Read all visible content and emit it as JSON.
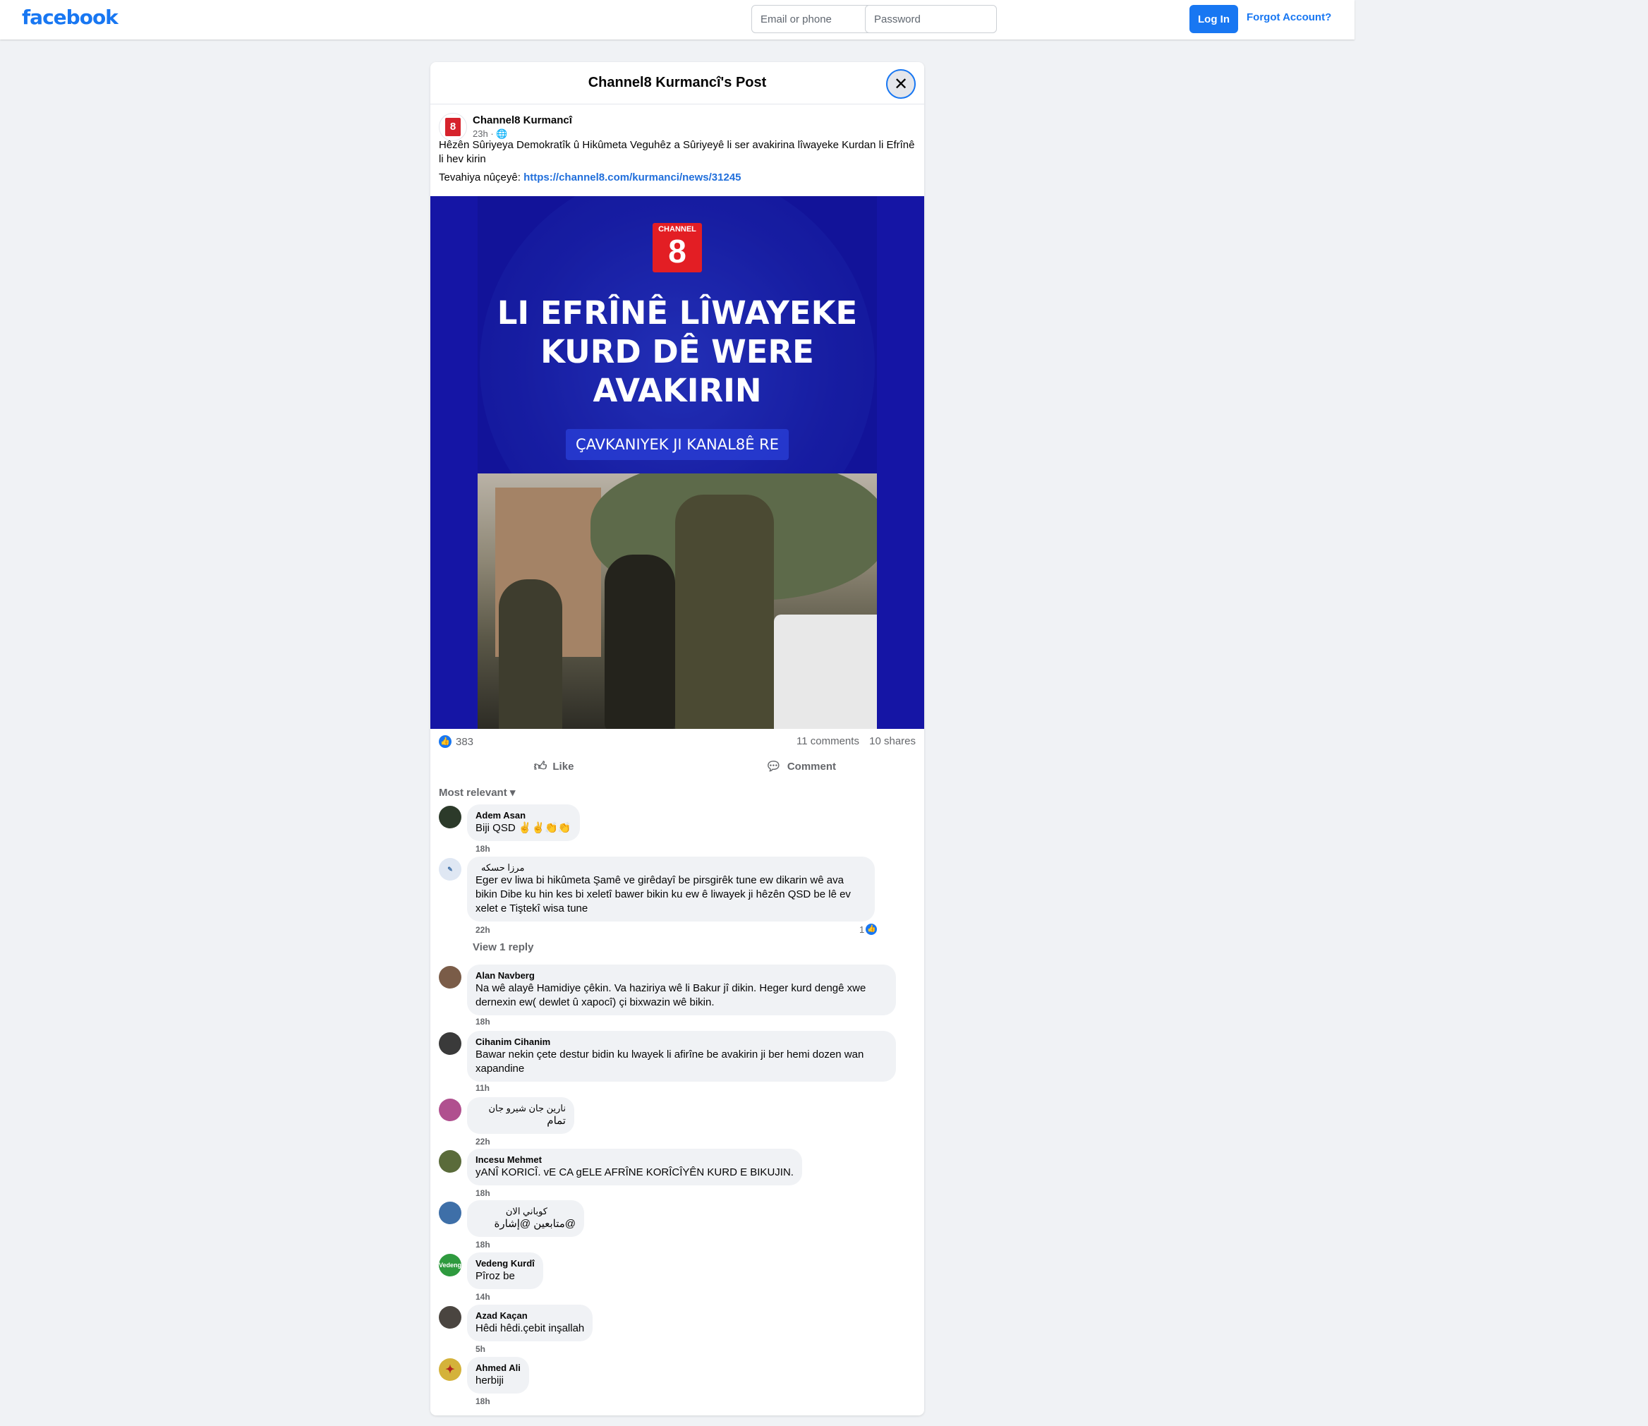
{
  "topbar": {
    "logo": "facebook",
    "email_placeholder": "Email or phone",
    "password_placeholder": "Password",
    "login_label": "Log In",
    "forgot_label": "Forgot Account?"
  },
  "dialog": {
    "title": "Channel8 Kurmancî's Post",
    "close_icon": "close-icon"
  },
  "post": {
    "page_name": "Channel8 Kurmancî",
    "avatar_badge": "8",
    "time": "23h",
    "audience_icon": "globe-icon",
    "text": "Hêzên Sûriyeya Demokratîk û Hikûmeta Veguhêz a Sûriyeyê li ser avakirina lîwayeke Kurdan li Efrînê li hev kirin",
    "link_prefix": "Tevahiya nûçeyê:",
    "link_url": "https://channel8.com/kurmanci/news/31245",
    "image": {
      "logo_top": "CHANNEL",
      "logo_num": "8",
      "headline": "LI EFRÎNÊ LÎWAYEKE\nKURD DÊ WERE\nAVAKIRIN",
      "source": "ÇAVKANIYEK JI KANAL8Ê RE"
    },
    "likes": "383",
    "comments": "11 comments",
    "shares": "10 shares",
    "like_label": "Like",
    "comment_label": "Comment",
    "sort_label": "Most relevant"
  },
  "comments": [
    {
      "author": "Adem Asan",
      "text": "Biji QSD ✌️✌️👏👏",
      "time": "18h",
      "avatar_color": "#2c3a2a"
    },
    {
      "author": "مرزا حسكه",
      "text": "Eger ev liwa bi hikûmeta Şamê ve girêdayî be pirsgirêk tune ew dikarin wê ava bikin Dibe ku hin kes bi xeletî bawer bikin ku ew ê liwayek ji hêzên QSD be lê ev xelet e Tiştekî wisa tune",
      "time": "22h",
      "reactions": "1",
      "view_reply": "View 1 reply",
      "avatar_color": "#dfe7f3"
    },
    {
      "author": "Alan Navberg",
      "text": "Na wê alayê Hamidiye çêkin. Va haziriya wê li Bakur jî dikin. Heger kurd dengê xwe dernexin ew( dewlet û xapocî) çi bixwazin wê bikin.",
      "time": "18h",
      "avatar_color": "#7a5c48"
    },
    {
      "author": "Cihanim Cihanim",
      "text": "Bawar nekin çete destur bidin ku lwayek li afirîne be avakirin ji ber hemi dozen wan xapandine",
      "time": "11h",
      "avatar_color": "#3a3a3a"
    },
    {
      "author": "نارين جان شيرو جان",
      "text": "تمام",
      "time": "22h",
      "avatar_color": "#b0508f"
    },
    {
      "author": "Incesu Mehmet",
      "text": "yANÎ KORICÎ. vE CA gELE AFRÎNE KORÎCÎYÊN KURD E BIKUJIN.",
      "time": "18h",
      "avatar_color": "#5a6b3a"
    },
    {
      "author": "كوباني الان",
      "text": "@متابعين @إشارة",
      "time": "18h",
      "avatar_color": "#3e6fa8"
    },
    {
      "author": "Vedeng Kurdî",
      "text": "Pîroz be",
      "time": "14h",
      "avatar_color": "#2e9a3e",
      "avatar_text": "Vedeng"
    },
    {
      "author": "Azad Kaçan",
      "text": "Hêdi hêdi.çebit inşallah",
      "time": "5h",
      "avatar_color": "#4a4540"
    },
    {
      "author": "Ahmed Ali",
      "text": "herbiji",
      "time": "18h",
      "avatar_color": "#d4b23a",
      "avatar_text": "✦"
    }
  ]
}
